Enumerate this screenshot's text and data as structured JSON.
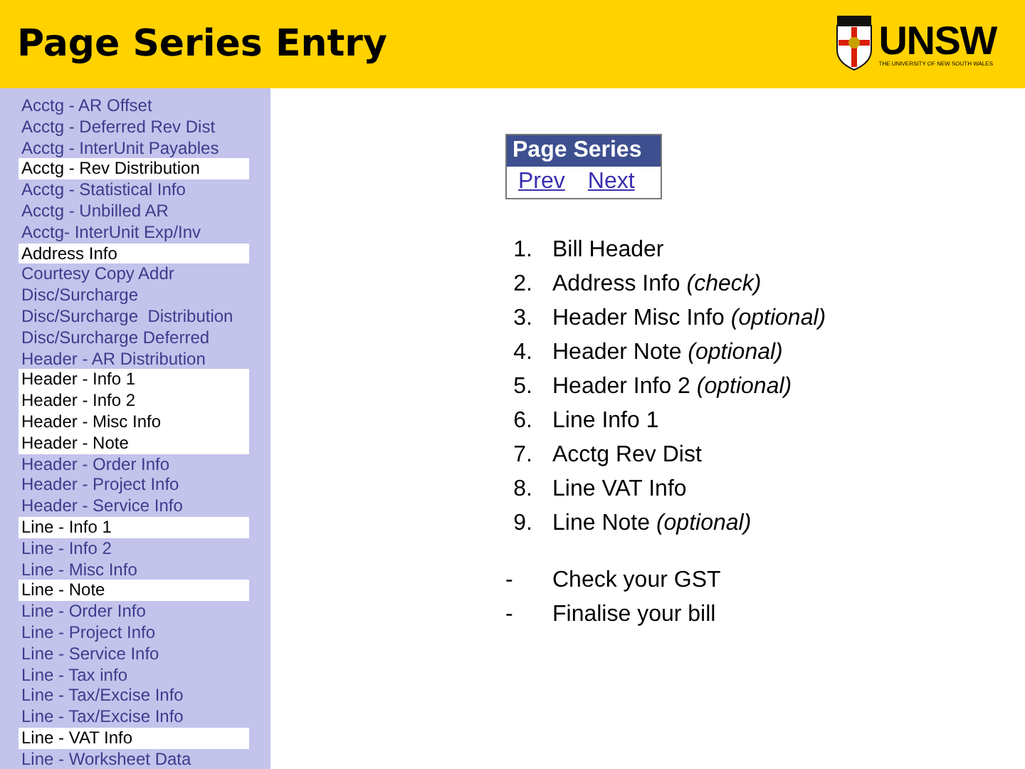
{
  "header": {
    "title": "Page Series Entry",
    "logo": {
      "name": "UNSW",
      "tagline": "THE UNIVERSITY OF NEW SOUTH WALES"
    }
  },
  "sidebar": {
    "items": [
      {
        "label": "Acctg - AR Offset",
        "selected": false
      },
      {
        "label": "Acctg - Deferred Rev Dist",
        "selected": false
      },
      {
        "label": "Acctg - InterUnit Payables",
        "selected": false
      },
      {
        "label": "Acctg - Rev Distribution",
        "selected": true
      },
      {
        "label": "Acctg - Statistical Info",
        "selected": false
      },
      {
        "label": "Acctg - Unbilled AR",
        "selected": false
      },
      {
        "label": "Acctg- InterUnit Exp/Inv",
        "selected": false
      },
      {
        "label": "Address Info",
        "selected": true
      },
      {
        "label": "Courtesy Copy Addr",
        "selected": false
      },
      {
        "label": "Disc/Surcharge",
        "selected": false
      },
      {
        "label": "Disc/Surcharge  Distribution",
        "selected": false
      },
      {
        "label": "Disc/Surcharge Deferred",
        "selected": false
      },
      {
        "label": "Header - AR Distribution",
        "selected": false
      },
      {
        "label": "Header - Info 1",
        "selected": true
      },
      {
        "label": "Header - Info 2",
        "selected": true
      },
      {
        "label": "Header - Misc Info",
        "selected": true
      },
      {
        "label": "Header - Note",
        "selected": true
      },
      {
        "label": "Header - Order Info",
        "selected": false
      },
      {
        "label": "Header - Project Info",
        "selected": false
      },
      {
        "label": "Header - Service Info",
        "selected": false
      },
      {
        "label": "Line - Info 1",
        "selected": true
      },
      {
        "label": "Line - Info 2",
        "selected": false
      },
      {
        "label": "Line - Misc Info",
        "selected": false
      },
      {
        "label": "Line - Note",
        "selected": true
      },
      {
        "label": "Line - Order Info",
        "selected": false
      },
      {
        "label": "Line - Project Info",
        "selected": false
      },
      {
        "label": "Line - Service Info",
        "selected": false
      },
      {
        "label": "Line - Tax info",
        "selected": false
      },
      {
        "label": "Line - Tax/Excise Info",
        "selected": false
      },
      {
        "label": "Line - Tax/Excise Info",
        "selected": false
      },
      {
        "label": "Line - VAT Info",
        "selected": true
      },
      {
        "label": "Line - Worksheet Data",
        "selected": false
      }
    ]
  },
  "page_series": {
    "title": "Page Series",
    "links": [
      "Prev",
      "Next"
    ]
  },
  "steps": [
    {
      "number": "1.",
      "text": "Bill Header"
    },
    {
      "number": "2.",
      "text": "Address Info *(check)*"
    },
    {
      "number": "3.",
      "text": "Header Misc Info *(optional)*"
    },
    {
      "number": "4.",
      "text": "Header Note *(optional)*"
    },
    {
      "number": "5.",
      "text": "Header Info 2 *(optional)*"
    },
    {
      "number": "6.",
      "text": "Line Info 1"
    },
    {
      "number": "7.",
      "text": "Acctg Rev Dist"
    },
    {
      "number": "8.",
      "text": "Line VAT Info"
    },
    {
      "number": "9.",
      "text": "Line Note *(optional)*"
    }
  ],
  "notes": [
    {
      "bullet": "-",
      "text": "Check your GST"
    },
    {
      "bullet": "-",
      "text": "Finalise your bill"
    }
  ]
}
